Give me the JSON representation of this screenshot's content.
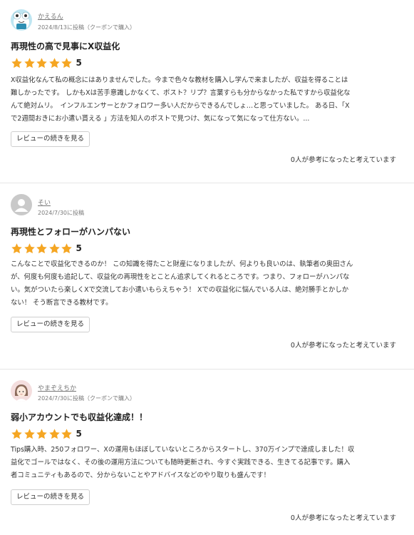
{
  "colors": {
    "star": "#f5a623",
    "divider": "#e6e6e6",
    "author_link": "#777777"
  },
  "reviews": [
    {
      "author": "かえるん",
      "meta": "2024/8/13に投稿（クーポンで購入）",
      "avatar_icon": "frog-character-avatar-icon",
      "title": "再現性の高で見事にX収益化",
      "stars": 5,
      "score": "5",
      "body_lines": [
        "X収益化なんて私の概念にはありませんでした。今まで色々な教材を購入し学んで来ましたが、収益を得ることは",
        "難しかったです。 しかもXは苦手意識しかなくて、ポスト？リプ？言葉すらも分からなかった私ですから収益化な",
        "んて絶対ムリ。　インフルエンサーとかフォロワー多い人だからできるんでしょ…と思っていました。 ある日、「X",
        "で2週間おきにお小遣い貰える 」方法を知人のポストで見つけ、気になって気になって仕方ない。..."
      ],
      "more_label": "レビューの続きを見る",
      "helpful": "0人が参考になったと考えています"
    },
    {
      "author": "そい",
      "meta": "2024/7/30に投稿",
      "avatar_icon": "default-user-avatar-icon",
      "title": "再現性とフォローがハンパない",
      "stars": 5,
      "score": "5",
      "body_lines": [
        "こんなことで収益化できるのか！ この知識を得たこと財産になりましたが、何よりも良いのは、執筆者の奥田さん",
        "が、何度も何度も追記して、収益化の再現性をとことん追求してくれるところです。つまり、フォローがハンパな",
        "い。気がついたら楽しくXで交流してお小遣いもらえちゃう！ Xでの収益化に悩んでいる人は、絶対勝手とかしか",
        "ない！ そう断言できる教材です。"
      ],
      "more_label": "レビューの続きを見る",
      "helpful": "0人が参考になったと考えています"
    },
    {
      "author": "やまぞえちか",
      "meta": "2024/7/30に投稿（クーポンで購入）",
      "avatar_icon": "illustrated-woman-avatar-icon",
      "title": "弱小アカウントでも収益化達成！！",
      "stars": 5,
      "score": "5",
      "body_lines": [
        "Tips購入時、250フォロワー、Xの運用もほぼしていないところからスタートし、370万インプで達成しました！収",
        "益化でゴールではなく、その後の運用方法についても随時更新され、今すぐ実践できる、生きてる記事です。購入",
        "者コミュニティもあるので、分からないことやアドバイスなどのやり取りも盛んです！"
      ],
      "more_label": "レビューの続きを見る",
      "helpful": "0人が参考になったと考えています"
    }
  ]
}
